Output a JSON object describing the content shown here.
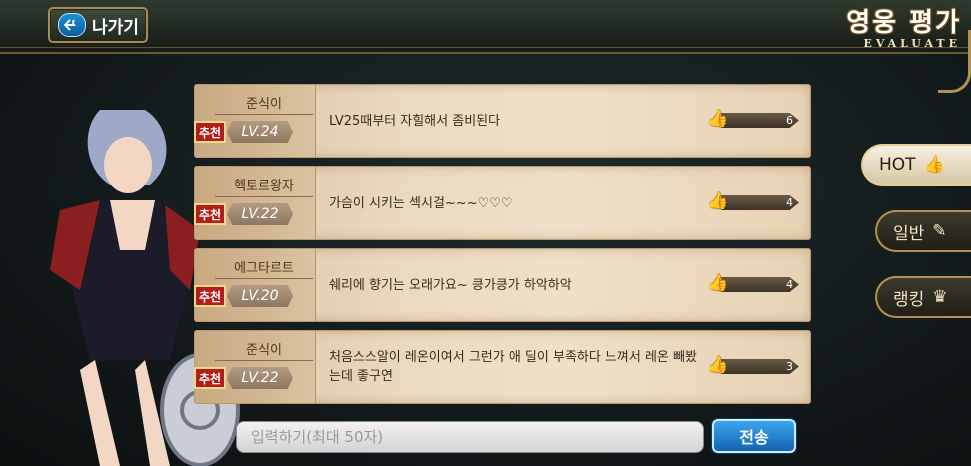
{
  "header": {
    "back_label": "나가기",
    "title": "영웅 평가",
    "subtitle": "EVALUATE"
  },
  "comments": [
    {
      "author": "준식이",
      "badge": "추천",
      "level": "LV.24",
      "text": "LV25때부터 자힐해서 좀비된다",
      "likes": "6"
    },
    {
      "author": "헥토르왕자",
      "badge": "추천",
      "level": "LV.22",
      "text": "가슴이 시키는 섹시걸~~~♡♡♡",
      "likes": "4"
    },
    {
      "author": "에그타르트",
      "badge": "추천",
      "level": "LV.20",
      "text": "쉐리에 향기는 오래가요~ 킁가킁가 하악하악",
      "likes": "4"
    },
    {
      "author": "준식이",
      "badge": "추천",
      "level": "LV.22",
      "text": "처음스스알이 레온이여서 그런가 애 딜이 부족하다 느껴서 레온 빼봤는데 좋구연",
      "likes": "3"
    }
  ],
  "tabs": [
    {
      "label": "HOT",
      "icon": "thumbs-up-icon",
      "active": true
    },
    {
      "label": "일반",
      "icon": "pencil-icon",
      "active": false
    },
    {
      "label": "랭킹",
      "icon": "crown-icon",
      "active": false
    }
  ],
  "input": {
    "placeholder": "입력하기(최대 50자)",
    "value": ""
  },
  "send_label": "전송",
  "colors": {
    "accent_gold": "#b39150",
    "send_blue": "#1f7fd0",
    "badge_red": "#b21f1a"
  }
}
